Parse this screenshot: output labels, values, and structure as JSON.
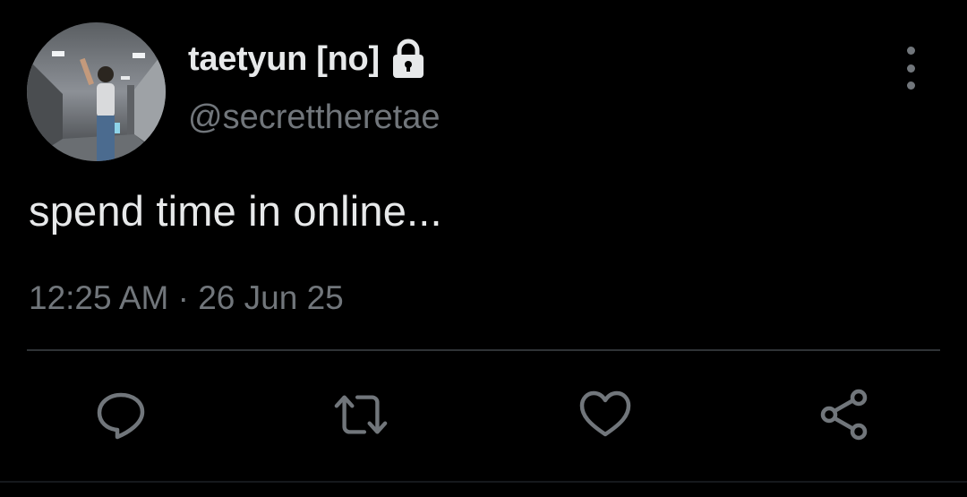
{
  "profile": {
    "display_name": "taetyun [no]",
    "handle": "@secrettheretae",
    "avatar": "profile-photo",
    "protected_icon": "lock-icon"
  },
  "tweet": {
    "text": "spend time in online...",
    "timestamp": "12:25 AM · 26 Jun 25"
  },
  "actions": [
    {
      "name": "reply",
      "icon": "reply-icon"
    },
    {
      "name": "retweet",
      "icon": "retweet-icon"
    },
    {
      "name": "like",
      "icon": "heart-icon"
    },
    {
      "name": "share",
      "icon": "share-icon"
    }
  ],
  "colors": {
    "background": "#000000",
    "primary_text": "#e7e9ea",
    "secondary_text": "#71767b",
    "divider": "#2f3336"
  }
}
